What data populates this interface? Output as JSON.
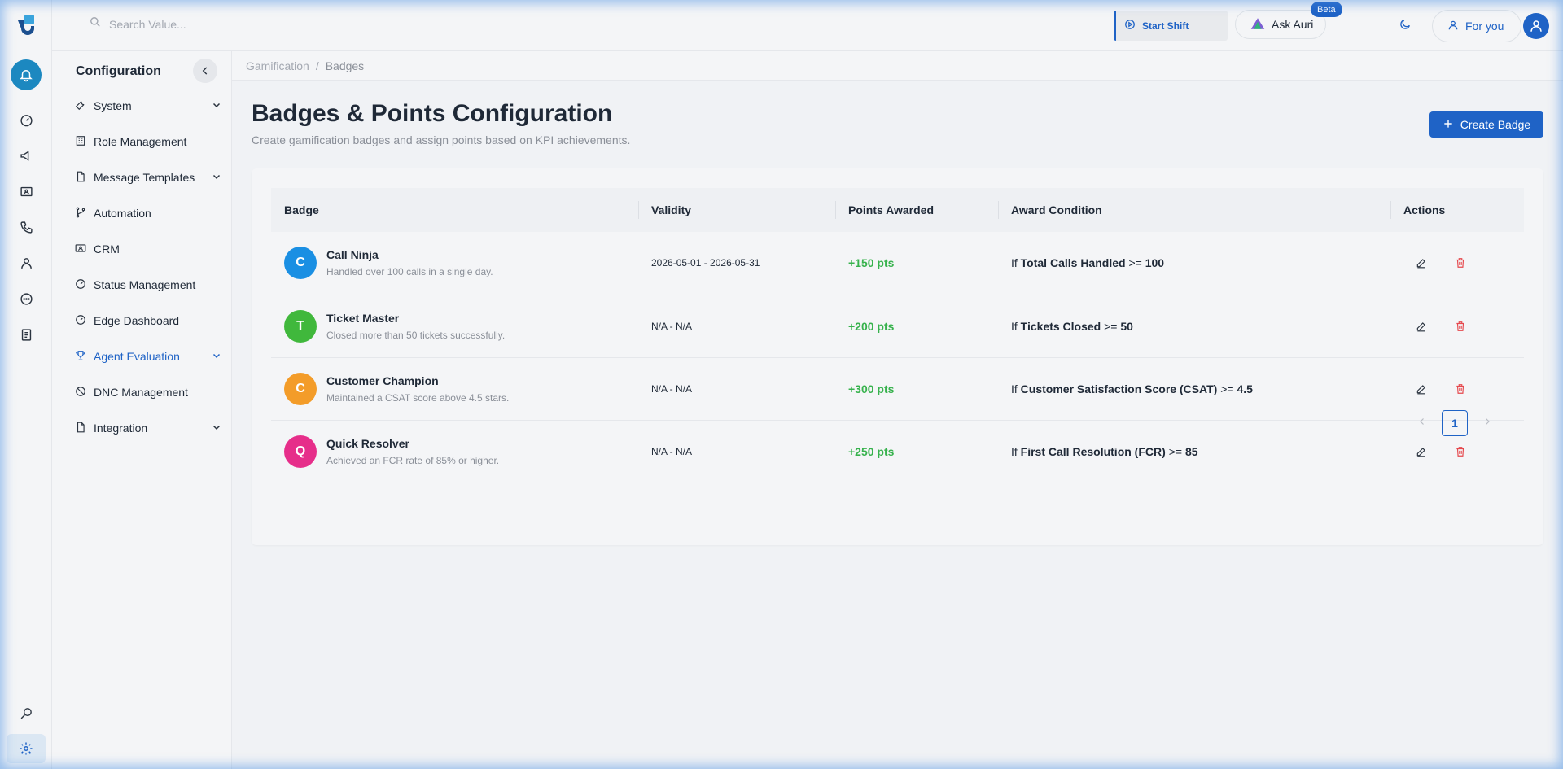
{
  "header": {
    "search_placeholder": "Search Value...",
    "start_shift_label": "Start Shift",
    "ask_auri_label": "Ask Auri",
    "beta_badge": "Beta",
    "for_you_label": "For you"
  },
  "rail": {
    "icons": [
      "notification-bell",
      "dashboard",
      "campaign",
      "contacts",
      "phone",
      "user",
      "chat",
      "reports",
      "search-settings",
      "settings"
    ]
  },
  "sidebar": {
    "title": "Configuration",
    "items": [
      {
        "label": "System",
        "icon": "wrench-icon",
        "expandable": true
      },
      {
        "label": "Role Management",
        "icon": "building-icon",
        "expandable": false
      },
      {
        "label": "Message Templates",
        "icon": "file-icon",
        "expandable": true
      },
      {
        "label": "Automation",
        "icon": "branch-icon",
        "expandable": false
      },
      {
        "label": "CRM",
        "icon": "id-card-icon",
        "expandable": false
      },
      {
        "label": "Status Management",
        "icon": "gauge-icon",
        "expandable": false
      },
      {
        "label": "Edge Dashboard",
        "icon": "gauge-icon",
        "expandable": false
      },
      {
        "label": "Agent Evaluation",
        "icon": "trophy-icon",
        "expandable": true,
        "active": true
      },
      {
        "label": "DNC Management",
        "icon": "block-icon",
        "expandable": false
      },
      {
        "label": "Integration",
        "icon": "file-icon",
        "expandable": true
      }
    ]
  },
  "breadcrumb": {
    "parent": "Gamification",
    "separator": "/",
    "current": "Badges"
  },
  "main": {
    "title": "Badges & Points Configuration",
    "subtitle": "Create gamification badges and assign points based on KPI achievements.",
    "create_button": "Create Badge"
  },
  "table": {
    "columns": [
      "Badge",
      "Validity",
      "Points Awarded",
      "Award Condition",
      "Actions"
    ],
    "rows": [
      {
        "initial": "C",
        "color": "#1a8fe3",
        "name": "Call Ninja",
        "desc": "Handled over 100 calls in a single day.",
        "validity": "2026-05-01 - 2026-05-31",
        "points": "+150 pts",
        "cond_prefix": "If",
        "cond_metric": "Total Calls Handled",
        "cond_op": ">=",
        "cond_value": "100"
      },
      {
        "initial": "T",
        "color": "#40b83c",
        "name": "Ticket Master",
        "desc": "Closed more than 50 tickets successfully.",
        "validity": "N/A - N/A",
        "points": "+200 pts",
        "cond_prefix": "If",
        "cond_metric": "Tickets Closed",
        "cond_op": ">=",
        "cond_value": "50"
      },
      {
        "initial": "C",
        "color": "#f39c29",
        "name": "Customer Champion",
        "desc": "Maintained a CSAT score above 4.5 stars.",
        "validity": "N/A - N/A",
        "points": "+300 pts",
        "cond_prefix": "If",
        "cond_metric": "Customer Satisfaction Score (CSAT)",
        "cond_op": ">=",
        "cond_value": "4.5"
      },
      {
        "initial": "Q",
        "color": "#e62e8a",
        "name": "Quick Resolver",
        "desc": "Achieved an FCR rate of 85% or higher.",
        "validity": "N/A - N/A",
        "points": "+250 pts",
        "cond_prefix": "If",
        "cond_metric": "First Call Resolution (FCR)",
        "cond_op": ">=",
        "cond_value": "85"
      }
    ]
  },
  "pagination": {
    "current_page": "1"
  },
  "colors": {
    "primary": "#1f63c6",
    "points_green": "#37b24d",
    "delete_red": "#e5484d"
  }
}
